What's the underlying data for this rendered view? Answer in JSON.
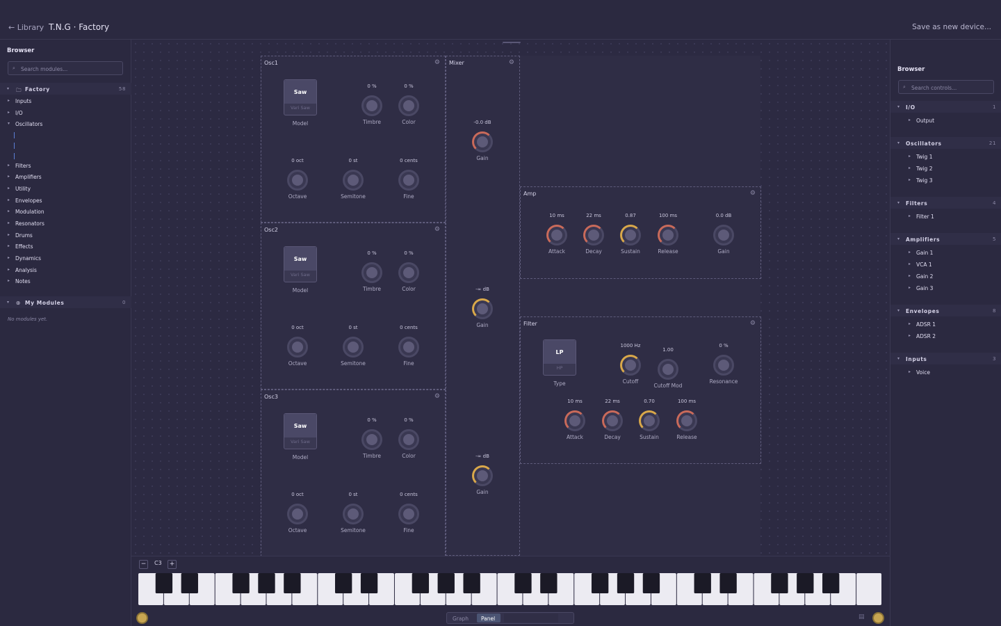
{
  "header": {
    "back_label": "← Library",
    "device_title": "T.N.G · Factory",
    "save_label": "Save as new device..."
  },
  "left_browser": {
    "title": "Browser",
    "search_placeholder": "Search modules...",
    "factory": {
      "label": "Factory",
      "count": "58"
    },
    "categories": [
      "Inputs",
      "I/O",
      "Oscillators",
      "Filters",
      "Amplifiers",
      "Utility",
      "Envelopes",
      "Modulation",
      "Resonators",
      "Drums",
      "Effects",
      "Dynamics",
      "Analysis",
      "Notes"
    ],
    "my_modules": {
      "label": "My Modules",
      "count": "0",
      "empty_text": "No modules yet."
    }
  },
  "right_browser": {
    "title": "Browser",
    "search_placeholder": "Search controls...",
    "groups": [
      {
        "label": "I/O",
        "count": "1",
        "items": [
          "Output"
        ]
      },
      {
        "label": "Oscillators",
        "count": "21",
        "items": [
          "Twig 1",
          "Twig 2",
          "Twig 3"
        ]
      },
      {
        "label": "Filters",
        "count": "4",
        "items": [
          "Filter 1"
        ]
      },
      {
        "label": "Amplifiers",
        "count": "5",
        "items": [
          "Gain 1",
          "VCA 1",
          "Gain 2",
          "Gain 3"
        ]
      },
      {
        "label": "Envelopes",
        "count": "8",
        "items": [
          "ADSR 1",
          "ADSR 2"
        ]
      },
      {
        "label": "Inputs",
        "count": "3",
        "items": [
          "Voice"
        ]
      }
    ]
  },
  "osc": [
    {
      "title": "Osc1",
      "model_sel": "Saw",
      "model_alt": "Vari Saw",
      "model": "Model",
      "timbre_val": "0 %",
      "timbre": "Timbre",
      "color_val": "0 %",
      "color": "Color",
      "oct_val": "0 oct",
      "oct": "Octave",
      "semi_val": "0 st",
      "semi": "Semitone",
      "fine_val": "0 cents",
      "fine": "Fine"
    },
    {
      "title": "Osc2",
      "model_sel": "Saw",
      "model_alt": "Vari Saw",
      "model": "Model",
      "timbre_val": "0 %",
      "timbre": "Timbre",
      "color_val": "0 %",
      "color": "Color",
      "oct_val": "0 oct",
      "oct": "Octave",
      "semi_val": "0 st",
      "semi": "Semitone",
      "fine_val": "0 cents",
      "fine": "Fine"
    },
    {
      "title": "Osc3",
      "model_sel": "Saw",
      "model_alt": "Vari Saw",
      "model": "Model",
      "timbre_val": "0 %",
      "timbre": "Timbre",
      "color_val": "0 %",
      "color": "Color",
      "oct_val": "0 oct",
      "oct": "Octave",
      "semi_val": "0 st",
      "semi": "Semitone",
      "fine_val": "0 cents",
      "fine": "Fine"
    }
  ],
  "mixer": {
    "title": "Mixer",
    "gains": [
      {
        "val": "-0.0 dB",
        "label": "Gain"
      },
      {
        "val": "-∞ dB",
        "label": "Gain"
      },
      {
        "val": "-∞ dB",
        "label": "Gain"
      }
    ]
  },
  "amp": {
    "title": "Amp",
    "knobs": [
      {
        "val": "10 ms",
        "label": "Attack"
      },
      {
        "val": "22 ms",
        "label": "Decay"
      },
      {
        "val": "0.87",
        "label": "Sustain"
      },
      {
        "val": "100 ms",
        "label": "Release"
      },
      {
        "val": "0.0 dB",
        "label": "Gain"
      }
    ]
  },
  "filter": {
    "title": "Filter",
    "type_sel": "LP",
    "type_alt": "HP",
    "type": "Type",
    "top": [
      {
        "val": "1000 Hz",
        "label": "Cutoff"
      },
      {
        "val": "1.00",
        "label": "Cutoff Mod"
      },
      {
        "val": "0 %",
        "label": "Resonance"
      }
    ],
    "env": [
      {
        "val": "10 ms",
        "label": "Attack"
      },
      {
        "val": "22 ms",
        "label": "Decay"
      },
      {
        "val": "0.70",
        "label": "Sustain"
      },
      {
        "val": "100 ms",
        "label": "Release"
      }
    ]
  },
  "keyboard": {
    "octave": "C3",
    "minus": "−",
    "plus": "+"
  },
  "view_switch": {
    "graph": "Graph",
    "panel": "Panel"
  },
  "colors": {
    "accent": "#d9a84a",
    "bg": "#2b2940"
  }
}
